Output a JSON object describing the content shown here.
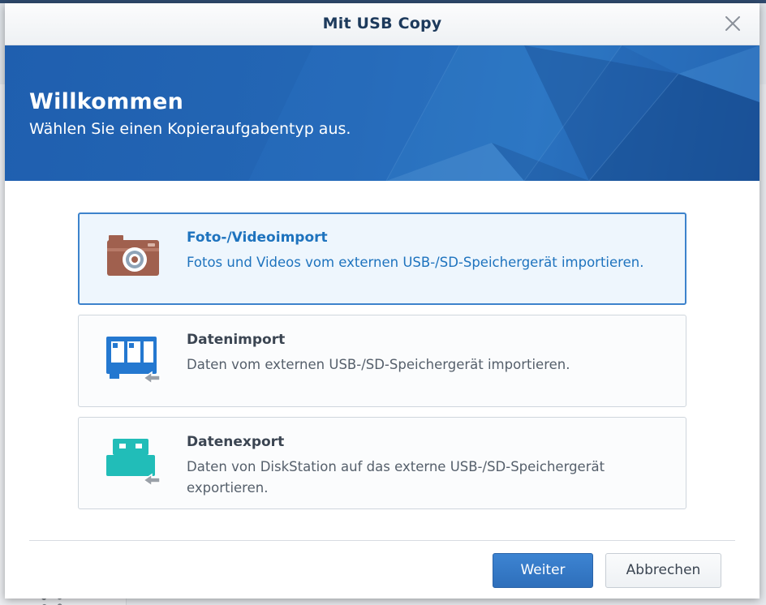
{
  "window": {
    "title": "Mit USB Copy",
    "close_icon": "close-icon"
  },
  "banner": {
    "title": "Willkommen",
    "subtitle": "Wählen Sie einen Kopieraufgabentyp aus."
  },
  "options": [
    {
      "id": "photo-video-import",
      "title": "Foto-/Videoimport",
      "description": "Fotos und Videos vom externen USB-/SD-Speichergerät importieren.",
      "icon": "camera-icon",
      "selected": true
    },
    {
      "id": "data-import",
      "title": "Datenimport",
      "description": "Daten vom externen USB-/SD-Speichergerät importieren.",
      "icon": "sd-card-import-icon",
      "selected": false
    },
    {
      "id": "data-export",
      "title": "Datenexport",
      "description": "Daten von DiskStation auf das externe USB-/SD-Speichergerät exportieren.",
      "icon": "usb-export-icon",
      "selected": false
    }
  ],
  "buttons": {
    "next_label": "Weiter",
    "cancel_label": "Abbrechen"
  },
  "colors": {
    "accent": "#1e73be",
    "banner": "#2467b5",
    "primary_button": "#3479c6",
    "camera": "#a0604e",
    "sd_card": "#2478d0",
    "usb": "#21bdb8"
  }
}
